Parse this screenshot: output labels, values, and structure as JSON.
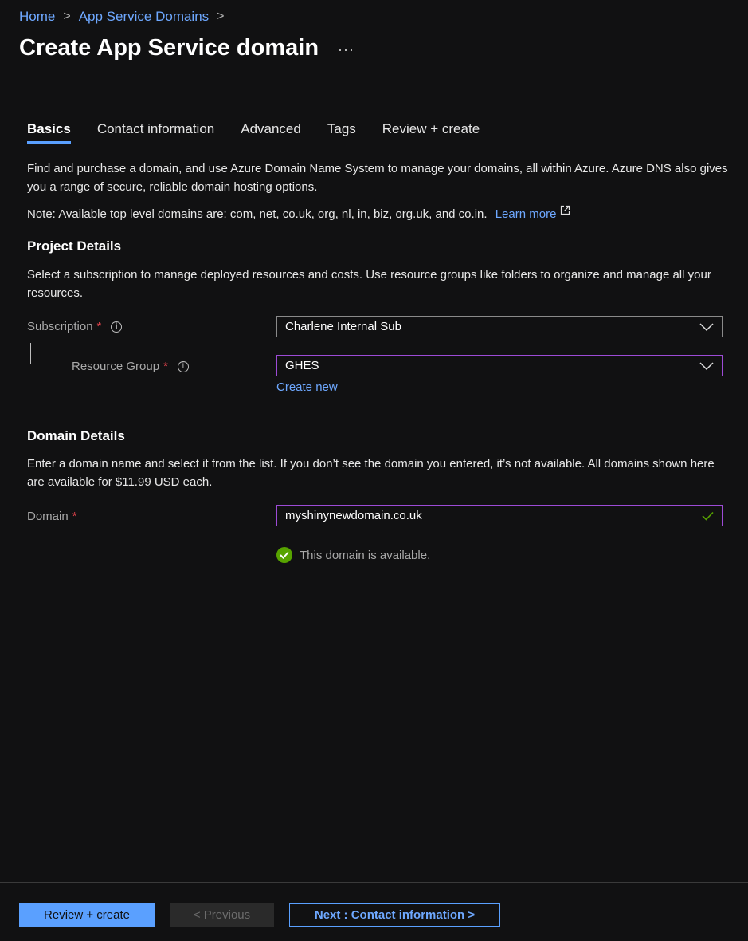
{
  "breadcrumb": {
    "home": "Home",
    "parent": "App Service Domains",
    "sep": ">"
  },
  "header": {
    "title": "Create App Service domain",
    "more": "···"
  },
  "tabs": [
    {
      "label": "Basics",
      "active": true
    },
    {
      "label": "Contact information",
      "active": false
    },
    {
      "label": "Advanced",
      "active": false
    },
    {
      "label": "Tags",
      "active": false
    },
    {
      "label": "Review + create",
      "active": false
    }
  ],
  "intro": {
    "description": "Find and purchase a domain, and use Azure Domain Name System to manage your domains, all within Azure. Azure DNS also gives you a range of secure, reliable domain hosting options.",
    "note": "Note: Available top level domains are: com, net, co.uk, org, nl, in, biz, org.uk, and co.in.",
    "learn_more": "Learn more"
  },
  "project": {
    "heading": "Project Details",
    "description": "Select a subscription to manage deployed resources and costs. Use resource groups like folders to organize and manage all your resources.",
    "subscription_label": "Subscription",
    "subscription_value": "Charlene Internal Sub",
    "resource_group_label": "Resource Group",
    "resource_group_value": "GHES",
    "create_new": "Create new",
    "required_mark": "*",
    "info_mark": "i"
  },
  "domain": {
    "heading": "Domain Details",
    "description": "Enter a domain name and select it from the list. If you don’t see the domain you entered, it’s not available. All domains shown here are available for $11.99 USD each.",
    "label": "Domain",
    "value": "myshinynewdomain.co.uk",
    "status": "This domain is available."
  },
  "footer": {
    "review_create": "Review + create",
    "previous": "< Previous",
    "next": "Next : Contact information >"
  },
  "colors": {
    "accent": "#5aa0ff",
    "focus_border": "#9d4bd6",
    "success": "#57a300",
    "required": "#e0434c"
  }
}
